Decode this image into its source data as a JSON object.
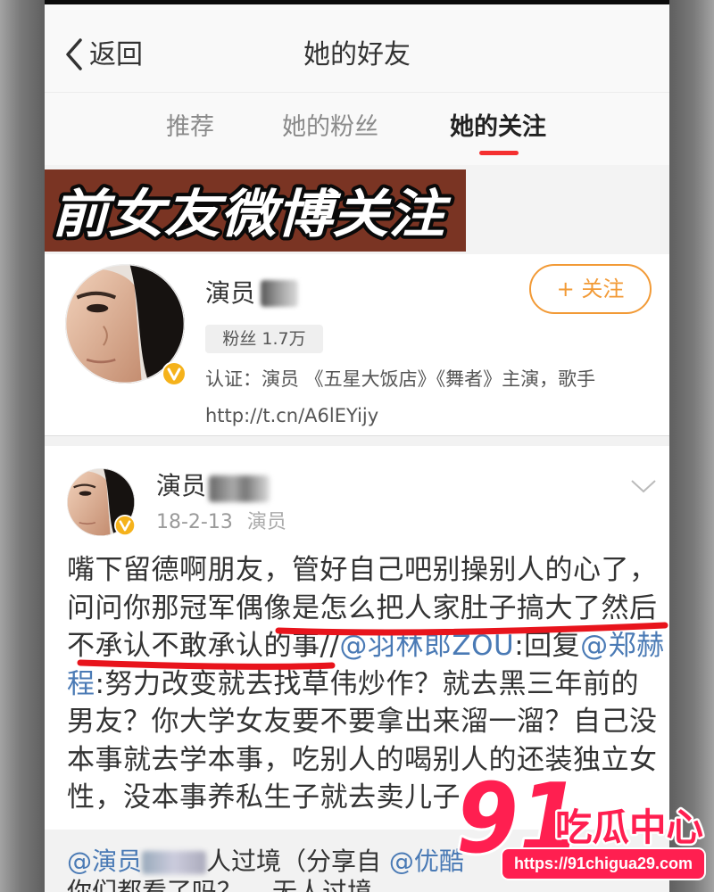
{
  "header": {
    "back_label": "返回",
    "title": "她的好友"
  },
  "tabs": [
    {
      "label": "推荐",
      "active": false
    },
    {
      "label": "她的粉丝",
      "active": false
    },
    {
      "label": "她的关注",
      "active": true
    }
  ],
  "banner": {
    "text": "前女友微博关注"
  },
  "user_card": {
    "name": "演员",
    "follow_label": "+ 关注",
    "fans": "粉丝 1.7万",
    "verification": "认证：演员 《五星大饭店》《舞者》主演，歌手",
    "link": "http://t.cn/A6lEYijy"
  },
  "post": {
    "author": "演员",
    "date": "18-2-13",
    "source": "演员",
    "lines": [
      [
        {
          "text": "嘴下留德啊朋友，管好自己吧别操别人的心了，",
          "link": false
        }
      ],
      [
        {
          "text": "问问你那冠军偶像是怎么把人家肚子搞大了然后",
          "link": false
        }
      ],
      [
        {
          "text": "不承认不敢承认的事//",
          "link": false
        },
        {
          "text": "@羽林郎ZOU",
          "link": true
        },
        {
          "text": ":回复",
          "link": false
        },
        {
          "text": "@郑赫",
          "link": true
        }
      ],
      [
        {
          "text": "程",
          "link": true
        },
        {
          "text": ":努力改变就去找草伟炒作？就去黑三年前的",
          "link": false
        }
      ],
      [
        {
          "text": "男友？你大学女友要不要拿出来溜一溜？自己没",
          "link": false
        }
      ],
      [
        {
          "text": "本事就去学本事，吃别人的喝别人的还装独立女",
          "link": false
        }
      ],
      [
        {
          "text": "性，没本事养私生子就去卖儿子",
          "link": false
        }
      ]
    ]
  },
  "repost": {
    "segments": [
      {
        "text": "@演员",
        "link": true
      },
      {
        "text": "人过境（分享自 ",
        "link": false
      },
      {
        "text": "@优酷",
        "link": true
      }
    ],
    "second_line": "你们都看了吗？",
    "second_line_title": "无人过境"
  },
  "watermark": {
    "number": "91",
    "text": "吃瓜中心",
    "url": "https://91chigua29.com"
  },
  "colors": {
    "tab_indicator": "#f53030",
    "mention": "#4a7ab5",
    "follow": "#f29a36",
    "verified": "#f5b21b",
    "banner_bg": "#7a3423",
    "annotation_red": "#e8141c",
    "watermark_red": "#ff1f50"
  },
  "icons": {
    "back": "chevron-left-icon",
    "post_menu": "chevron-down-icon",
    "verified": "verified-badge-icon",
    "avatar": "avatar"
  }
}
